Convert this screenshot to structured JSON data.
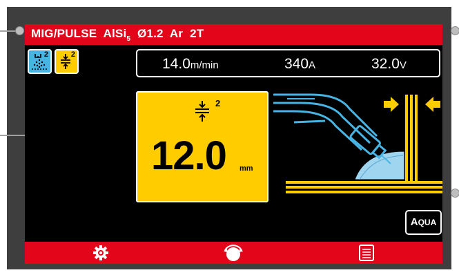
{
  "title_bar": {
    "process": "MIG/PULSE",
    "material_main": "AlSi",
    "material_sub": "5",
    "wire": "Ø1.2",
    "gas": "Ar",
    "trigger": "2T"
  },
  "mode_buttons": [
    {
      "icon": "spatter-settings-icon",
      "superscript": "2",
      "color": "#48b4e4"
    },
    {
      "icon": "thickness-icon",
      "superscript": "2",
      "color": "#ffcc00"
    }
  ],
  "readout": {
    "wire_speed_value": "14.0",
    "wire_speed_unit": "m/min",
    "current_value": "340",
    "current_unit": "A",
    "voltage_value": "32.0",
    "voltage_unit": "V"
  },
  "parameter": {
    "icon": "thickness-icon",
    "superscript": "2",
    "value": "12.0",
    "unit": "mm"
  },
  "illustration": {
    "icon": "fillet-weld-torch-illustration",
    "accent": "#48b4e4",
    "plate": "#ffcc00"
  },
  "aqua_button": {
    "first": "A",
    "rest": "QUA"
  },
  "bottom_bar": [
    {
      "icon": "gear-icon"
    },
    {
      "icon": "encoder-knob-icon"
    },
    {
      "icon": "menu-list-icon"
    }
  ],
  "colors": {
    "brand_red": "#e3061a",
    "yellow": "#ffcc00",
    "blue": "#48b4e4",
    "frame": "#3e3e3e"
  }
}
